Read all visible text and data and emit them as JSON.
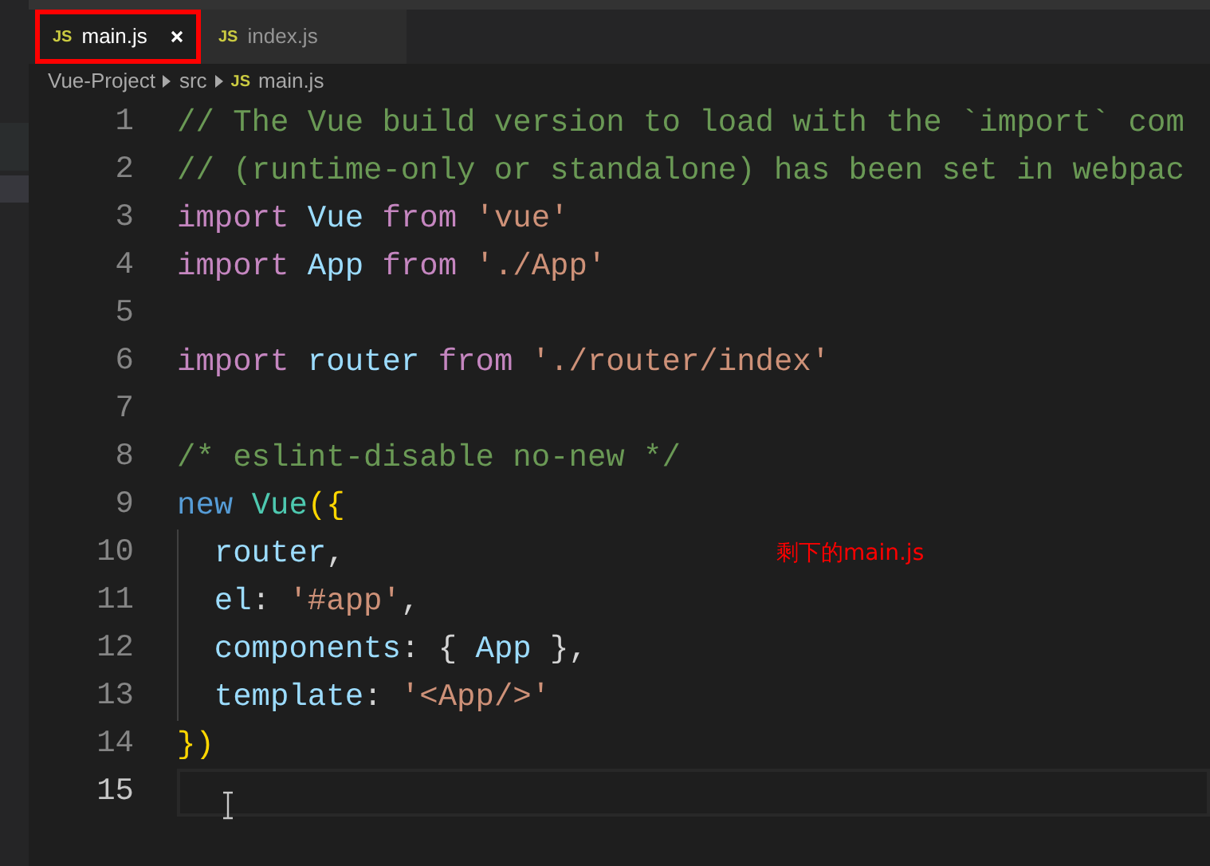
{
  "tabs": [
    {
      "label": "main.js",
      "icon": "JS",
      "selected": true,
      "highlighted": true
    },
    {
      "label": "index.js",
      "icon": "JS",
      "selected": false,
      "highlighted": false
    }
  ],
  "breadcrumb": [
    {
      "label": "Vue-Project"
    },
    {
      "label": "src"
    },
    {
      "label": "main.js",
      "icon": "JS"
    }
  ],
  "editor": {
    "lines": [
      {
        "number": "1",
        "current": false,
        "guide": false,
        "tokens": [
          {
            "kind": "comment",
            "text": "// The Vue build version to load with the `import` com"
          }
        ]
      },
      {
        "number": "2",
        "current": false,
        "guide": false,
        "tokens": [
          {
            "kind": "comment",
            "text": "// (runtime-only or standalone) has been set in webpac"
          }
        ]
      },
      {
        "number": "3",
        "current": false,
        "guide": false,
        "tokens": [
          {
            "kind": "keyword",
            "text": "import "
          },
          {
            "kind": "variable",
            "text": "Vue "
          },
          {
            "kind": "keyword",
            "text": "from "
          },
          {
            "kind": "string",
            "text": "'vue'"
          }
        ]
      },
      {
        "number": "4",
        "current": false,
        "guide": false,
        "tokens": [
          {
            "kind": "keyword",
            "text": "import "
          },
          {
            "kind": "variable",
            "text": "App "
          },
          {
            "kind": "keyword",
            "text": "from "
          },
          {
            "kind": "string",
            "text": "'./App'"
          }
        ]
      },
      {
        "number": "5",
        "current": false,
        "guide": false
      },
      {
        "number": "6",
        "current": false,
        "guide": false,
        "tokens": [
          {
            "kind": "keyword",
            "text": "import "
          },
          {
            "kind": "variable",
            "text": "router "
          },
          {
            "kind": "keyword",
            "text": "from "
          },
          {
            "kind": "string",
            "text": "'./router/index'"
          }
        ]
      },
      {
        "number": "7",
        "current": false,
        "guide": false
      },
      {
        "number": "8",
        "current": false,
        "guide": false,
        "tokens": [
          {
            "kind": "comment",
            "text": "/* eslint-disable no-new */"
          }
        ]
      },
      {
        "number": "9",
        "current": false,
        "guide": false,
        "tokens": [
          {
            "kind": "storage",
            "text": "new "
          },
          {
            "kind": "class",
            "text": "Vue"
          },
          {
            "kind": "bracket",
            "text": "({"
          }
        ]
      },
      {
        "number": "10",
        "current": false,
        "guide": true,
        "tokens": [
          {
            "kind": "variable",
            "text": "  router"
          },
          {
            "kind": "plain",
            "text": ","
          }
        ]
      },
      {
        "number": "11",
        "current": false,
        "guide": true,
        "tokens": [
          {
            "kind": "variable",
            "text": "  el"
          },
          {
            "kind": "plain",
            "text": ": "
          },
          {
            "kind": "string",
            "text": "'#app'"
          },
          {
            "kind": "plain",
            "text": ","
          }
        ]
      },
      {
        "number": "12",
        "current": false,
        "guide": true,
        "tokens": [
          {
            "kind": "variable",
            "text": "  components"
          },
          {
            "kind": "plain",
            "text": ": { "
          },
          {
            "kind": "variable",
            "text": "App"
          },
          {
            "kind": "plain",
            "text": " },"
          }
        ]
      },
      {
        "number": "13",
        "current": false,
        "guide": true,
        "tokens": [
          {
            "kind": "variable",
            "text": "  template"
          },
          {
            "kind": "plain",
            "text": ": "
          },
          {
            "kind": "string",
            "text": "'<App/>'"
          }
        ]
      },
      {
        "number": "14",
        "current": false,
        "guide": false,
        "tokens": [
          {
            "kind": "bracket",
            "text": "})"
          }
        ]
      },
      {
        "number": "15",
        "current": true,
        "guide": false
      }
    ]
  },
  "annotation": {
    "text": "剩下的main.js"
  }
}
